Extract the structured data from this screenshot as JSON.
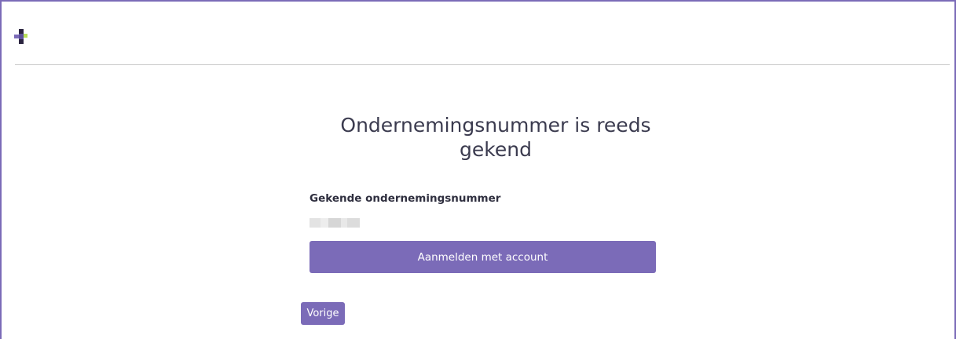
{
  "header": {
    "logo_icon": "puzzle-pixel-logo-icon",
    "colors": {
      "accent": "#7b6bb8",
      "logo_dark": "#2b2440",
      "logo_light": "#b9e05a"
    }
  },
  "main": {
    "title": "Ondernemingsnummer is reeds gekend",
    "field_label": "Gekende ondernemingsnummer",
    "field_value_masked": true,
    "login_button_label": "Aanmelden met account",
    "back_button_label": "Vorige"
  }
}
